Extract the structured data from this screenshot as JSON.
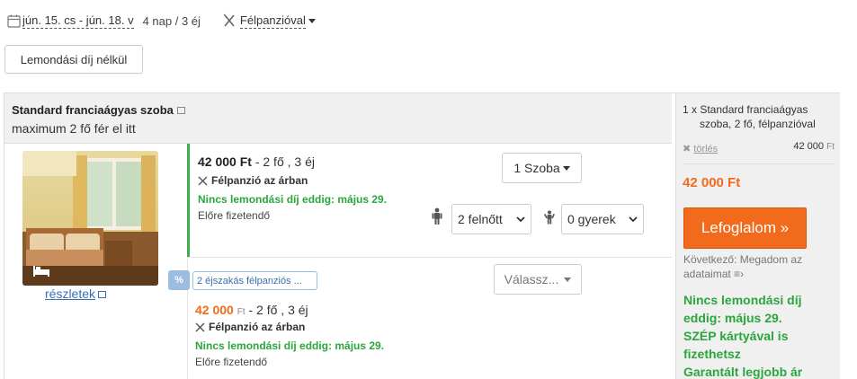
{
  "search": {
    "date_range": "jún. 15. cs - jún. 18. v",
    "nights": "4 nap / 3 éj",
    "board": "Félpanzióval"
  },
  "filters": {
    "free_cancel_label": "Lemondási díj nélkül"
  },
  "room": {
    "title": "Standard franciaágyas szoba",
    "capacity": "maximum 2 fő fér el itt",
    "details_link": "részletek"
  },
  "offers": [
    {
      "price": "42 000 Ft",
      "price_suffix": " - 2 fő , 3 éj",
      "meal": "Félpanzió az árban",
      "cancel": "Nincs lemondási díj eddig: május 29.",
      "payment": "Előre fizetendő",
      "room_select": "1 Szoba",
      "adults_select": "2 felnőtt",
      "children_select": "0 gyerek"
    },
    {
      "badge": "%",
      "tag": "2 éjszakás félpanziós ...",
      "price_amount": "42 000",
      "price_currency": "Ft",
      "price_suffix": " - 2 fő , 3 éj",
      "meal": "Félpanzió az árban",
      "cancel": "Nincs lemondási díj eddig: május 29.",
      "payment": "Előre fizetendő",
      "select": "Válassz..."
    }
  ],
  "summary": {
    "line1": "1 x Standard franciaágyas",
    "line2": "szoba, 2 fő, félpanzióval",
    "delete_label": "törlés",
    "item_price": "42 000",
    "item_currency": "Ft",
    "total": "42 000 Ft",
    "book_button": "Lefoglalom »",
    "next_step": "Következő: Megadom az adataimat",
    "green_lines": [
      "Nincs lemondási díj",
      "eddig: május 29.",
      "SZÉP kártyával is",
      "fizethetsz",
      "Garantált legjobb ár"
    ]
  },
  "colors": {
    "accent": "#f26a1b",
    "green": "#2aa63c",
    "link": "#3a6fb0"
  }
}
